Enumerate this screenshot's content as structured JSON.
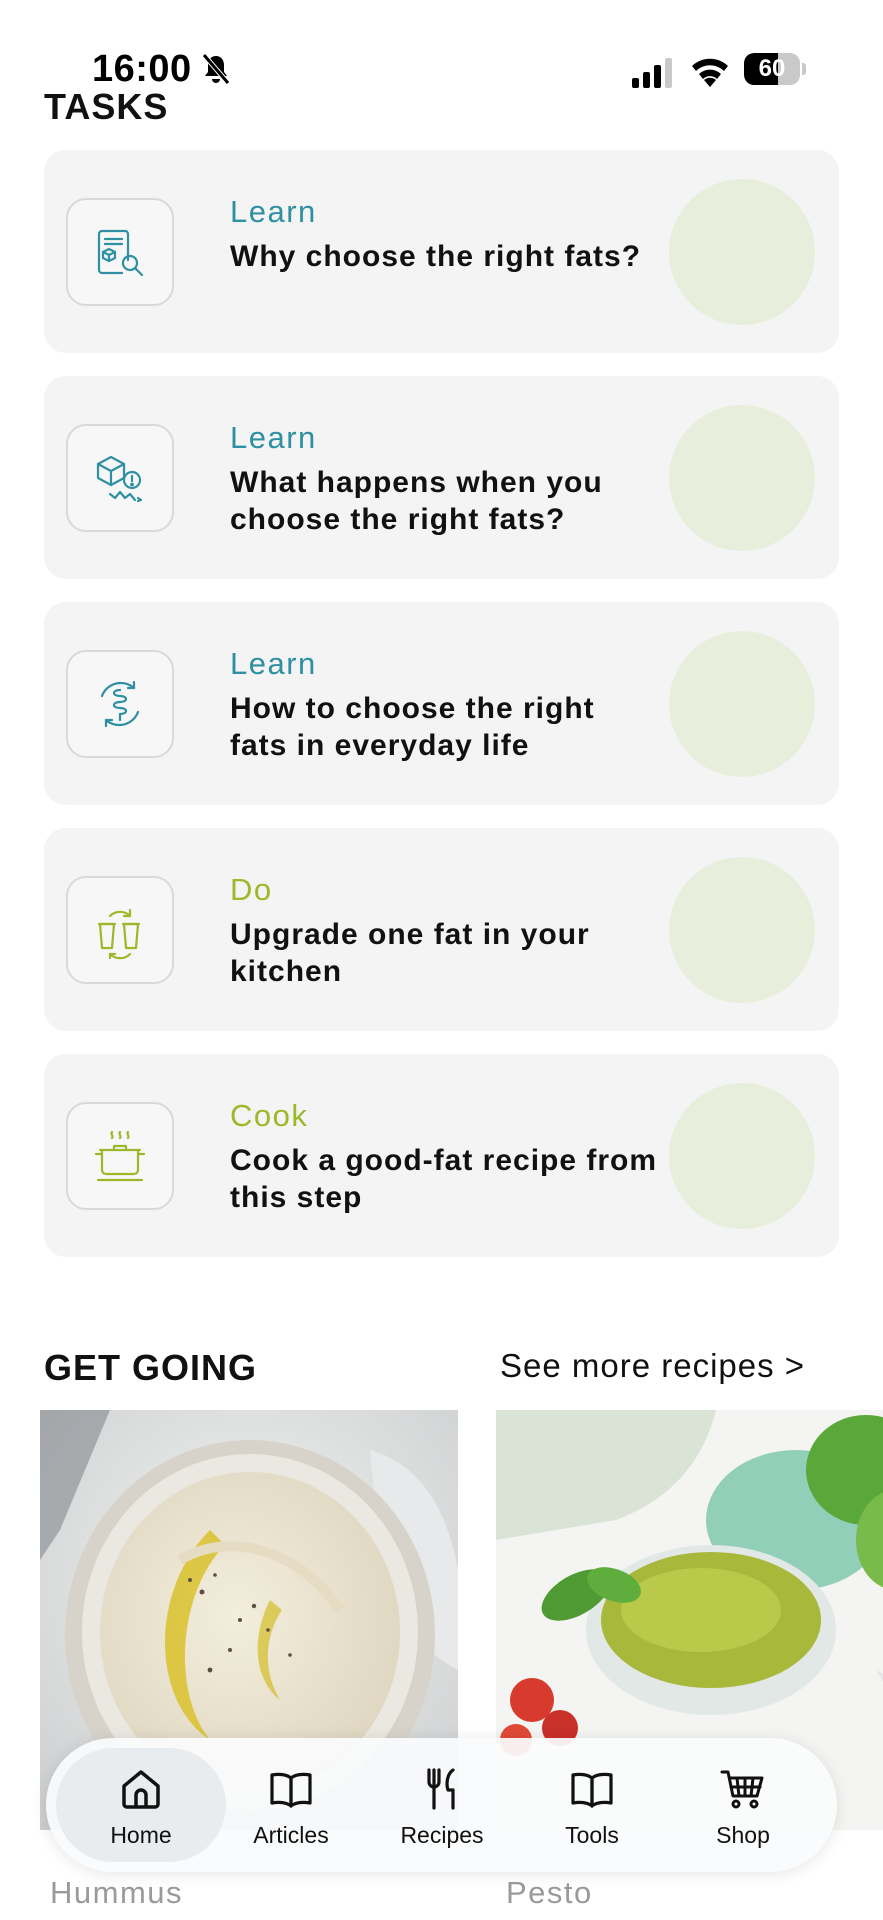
{
  "status_bar": {
    "time": "16:00",
    "battery": "60",
    "battery_level": 0.6
  },
  "tasks": {
    "title": "TASKS",
    "items": [
      {
        "category": "Learn",
        "title": "Why choose the right fats?",
        "icon": "document-search-icon"
      },
      {
        "category": "Learn",
        "title": "What happens when you choose the right fats?",
        "icon": "cube-warning-icon"
      },
      {
        "category": "Learn",
        "title": "How to choose the right fats in everyday life",
        "icon": "gut-cycle-icon"
      },
      {
        "category": "Do",
        "title": "Upgrade one fat in your kitchen",
        "icon": "swap-jars-icon"
      },
      {
        "category": "Cook",
        "title": "Cook a good-fat recipe from this step",
        "icon": "cooking-pot-icon"
      }
    ]
  },
  "get_going": {
    "title": "GET GOING",
    "see_more": "See more recipes >",
    "recipes": [
      {
        "name": "Hummus"
      },
      {
        "name": "Pesto"
      }
    ]
  },
  "nav": {
    "items": [
      {
        "label": "Home",
        "icon": "home-icon",
        "active": true
      },
      {
        "label": "Articles",
        "icon": "book-icon",
        "active": false
      },
      {
        "label": "Recipes",
        "icon": "fork-knife-icon",
        "active": false
      },
      {
        "label": "Tools",
        "icon": "open-book-icon",
        "active": false
      },
      {
        "label": "Shop",
        "icon": "cart-icon",
        "active": false
      }
    ]
  },
  "colors": {
    "learn": "#2f8fa3",
    "do_cook": "#9db828",
    "card_bg": "#f4f4f4",
    "circle": "#e8eedc"
  }
}
